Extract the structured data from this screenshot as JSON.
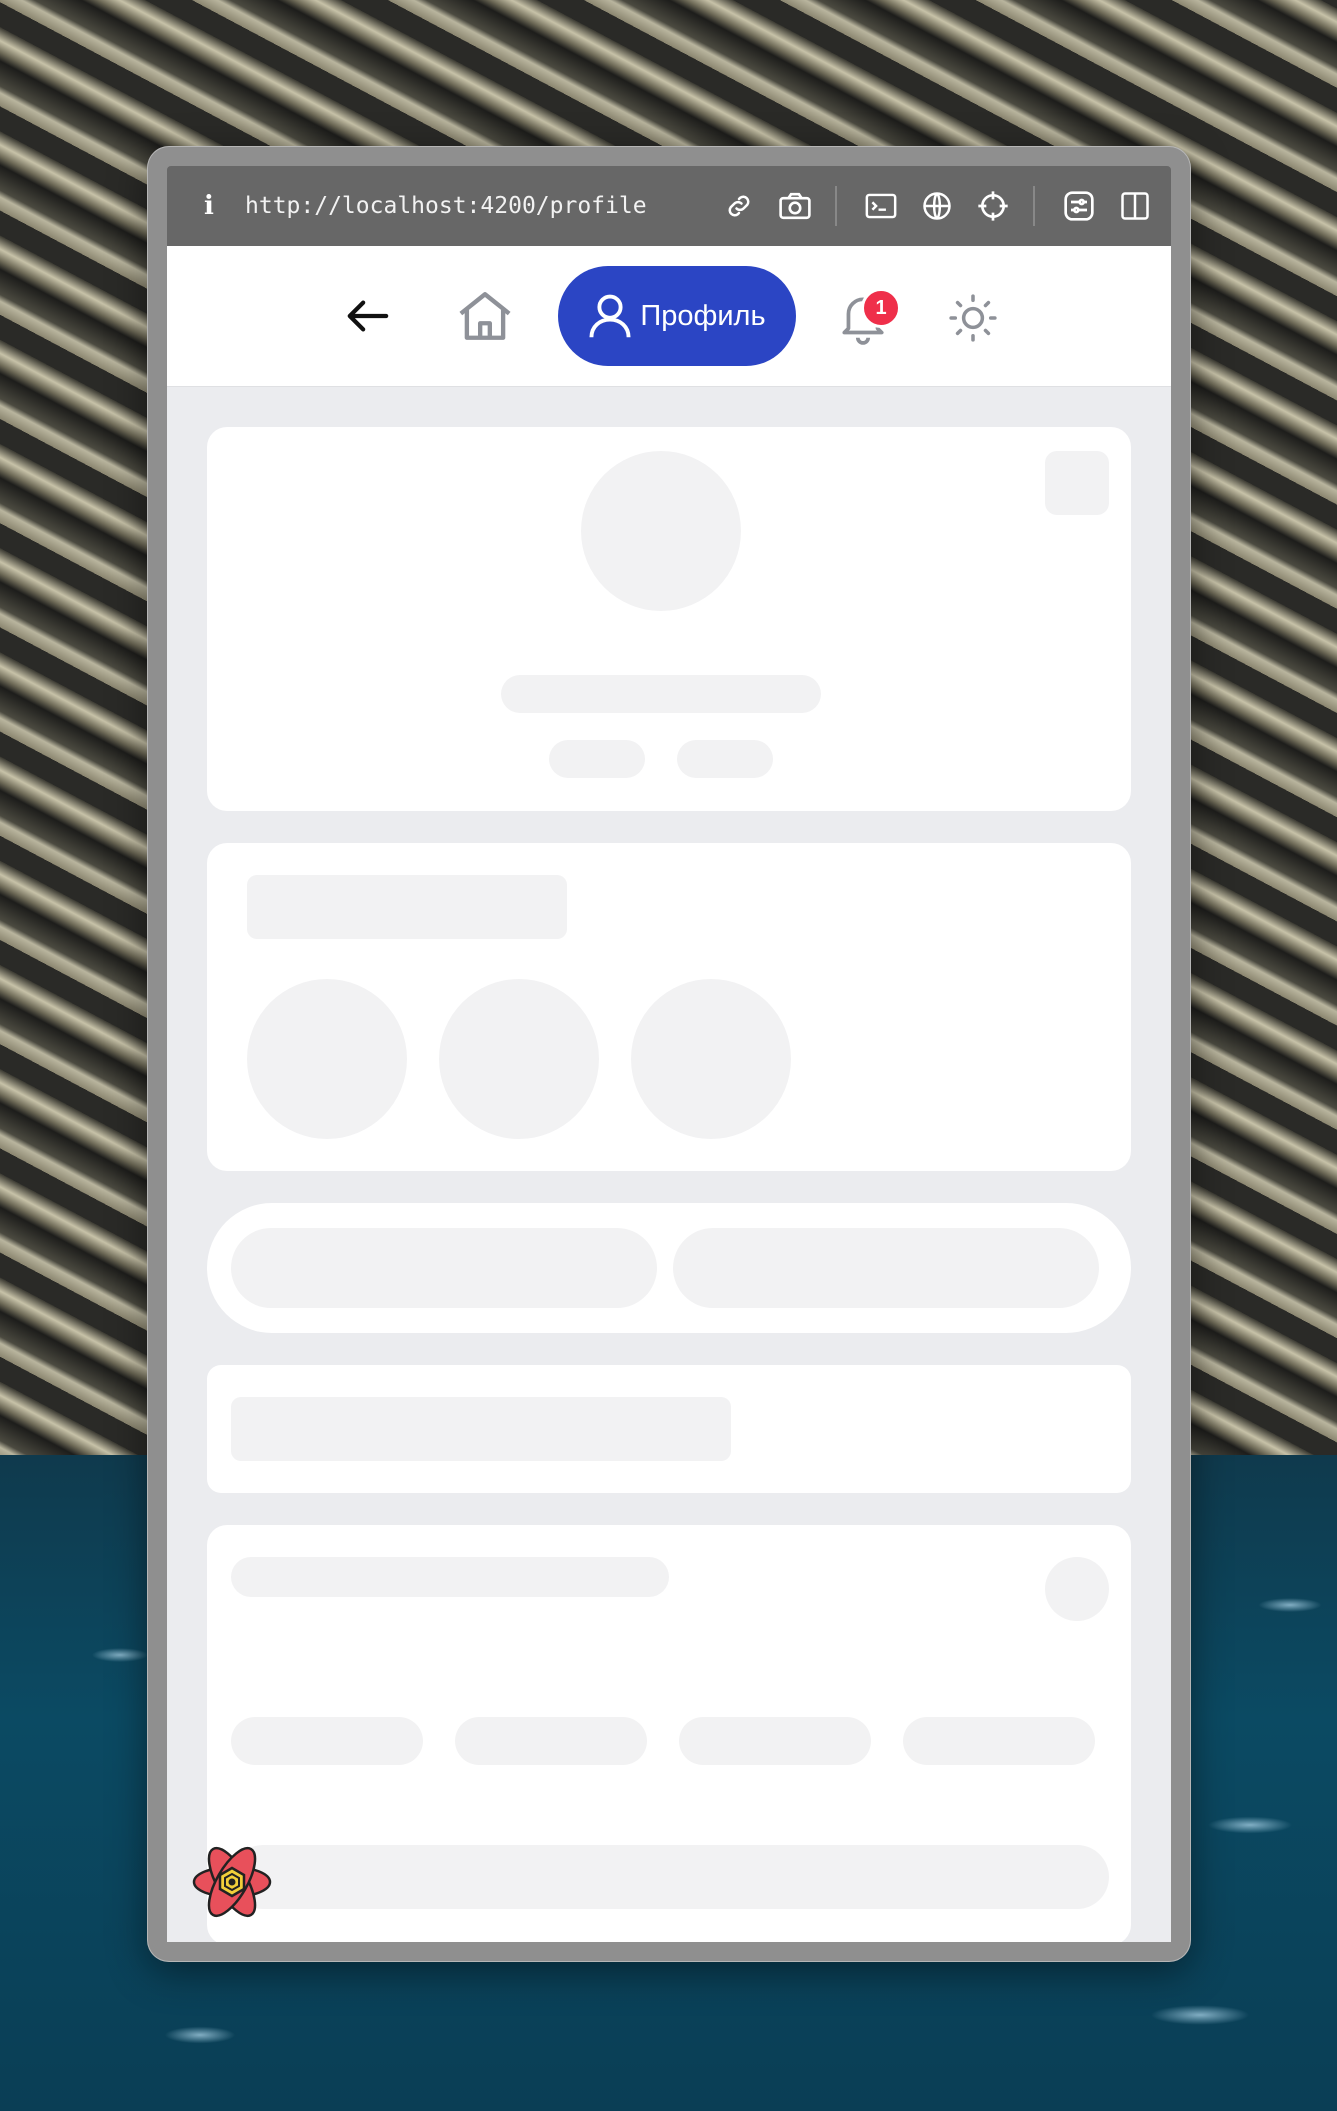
{
  "browser": {
    "url": "http://localhost:4200/profile",
    "info_label": "i"
  },
  "nav": {
    "profile_label": "Профиль",
    "notification_count": "1"
  },
  "colors": {
    "accent": "#2b45c4",
    "badge": "#ef2f4a",
    "skeleton": "#f2f2f3",
    "page_bg": "#ebecef"
  }
}
